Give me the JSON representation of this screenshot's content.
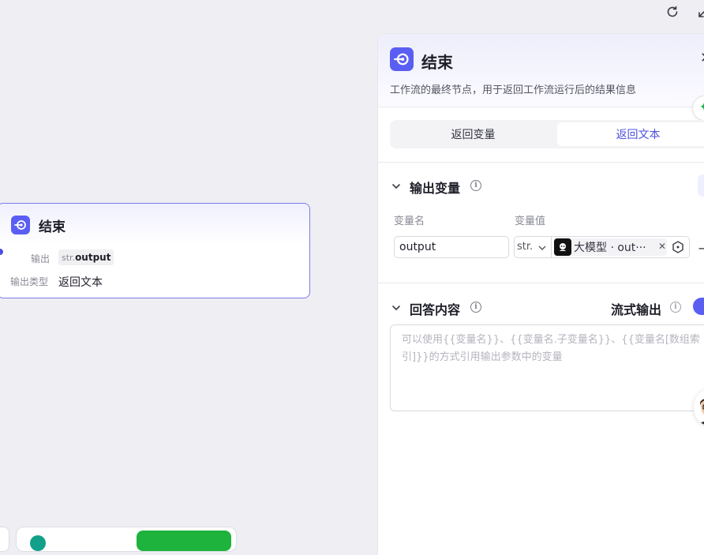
{
  "canvas_node": {
    "title": "结束",
    "output_label": "输出",
    "output_tag_prefix": "str.",
    "output_tag_name": "output",
    "output_type_label": "输出类型",
    "output_type_value": "返回文本"
  },
  "panel": {
    "title": "结束",
    "description": "工作流的最终节点，用于返回工作流运行后的结果信息",
    "tabs": [
      {
        "label": "返回变量",
        "active": false
      },
      {
        "label": "返回文本",
        "active": true
      }
    ],
    "output_section": {
      "title": "输出变量",
      "col_name_label": "变量名",
      "col_value_label": "变量值",
      "row": {
        "name": "output",
        "type": "str.",
        "ref_label": "大模型 · out···"
      }
    },
    "answer_section": {
      "title": "回答内容",
      "stream_label": "流式输出",
      "stream_enabled": true,
      "placeholder": "可以使用{{变量名}}、{{变量名.子变量名}}、{{变量名[数组索引]}}的方式引用输出参数中的变量"
    }
  },
  "colors": {
    "accent": "#5b5ef2",
    "active_tab_text": "#4d50e0",
    "run_button": "#1db33d"
  }
}
